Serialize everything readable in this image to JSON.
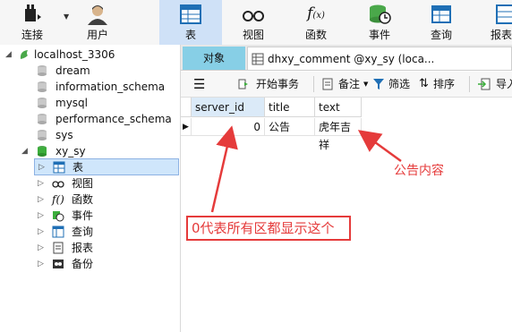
{
  "toolbar": {
    "items": [
      {
        "label": "连接",
        "icon": "connection-icon"
      },
      {
        "label": "用户",
        "icon": "user-icon"
      },
      {
        "label": "表",
        "icon": "table-icon",
        "active": true
      },
      {
        "label": "视图",
        "icon": "view-icon"
      },
      {
        "label": "函数",
        "icon": "function-icon"
      },
      {
        "label": "事件",
        "icon": "event-icon"
      },
      {
        "label": "查询",
        "icon": "query-icon"
      },
      {
        "label": "报表",
        "icon": "report-icon"
      }
    ]
  },
  "tree": {
    "connection": "localhost_3306",
    "databases": [
      "dream",
      "information_schema",
      "mysql",
      "performance_schema",
      "sys",
      "xy_sy"
    ],
    "children": [
      "表",
      "视图",
      "函数",
      "事件",
      "查询",
      "报表",
      "备份"
    ]
  },
  "tabs": {
    "objects": "对象",
    "doc": "dhxy_comment @xy_sy (loca..."
  },
  "subtoolbar": {
    "begin_tx": "开始事务",
    "note": "备注",
    "filter": "筛选",
    "sort": "排序",
    "import": "导入"
  },
  "grid": {
    "columns": [
      "server_id",
      "title",
      "text"
    ],
    "rows": [
      {
        "server_id": "0",
        "title": "公告",
        "text": "虎年吉祥"
      }
    ]
  },
  "annotations": {
    "box_text": "0代表所有区都显示这个",
    "content_label": "公告内容",
    "color": "#e53b3b"
  },
  "colors": {
    "active_tab": "#87cfe6",
    "selection": "#cfe6fb",
    "db_green": "#3cae3c"
  }
}
